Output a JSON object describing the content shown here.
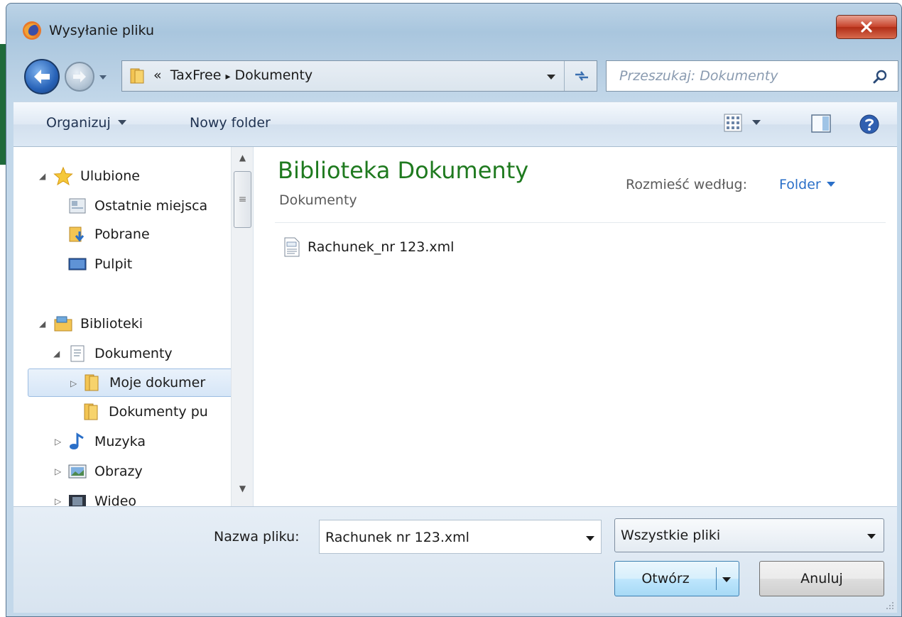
{
  "window": {
    "title": "Wysyłanie pliku",
    "close_icon": "close-icon",
    "accent": "#c7422a"
  },
  "navigation": {
    "breadcrumb_prefix": "«",
    "breadcrumb": [
      "TaxFree",
      "Dokumenty"
    ],
    "breadcrumb_separator": "▸",
    "search_placeholder": "Przeszukaj: Dokumenty"
  },
  "toolbar": {
    "organize_label": "Organizuj",
    "new_folder_label": "Nowy folder",
    "views_icon": "views-icon",
    "preview_icon": "preview-pane-icon",
    "help_icon": "help-icon"
  },
  "sidebar": {
    "favorites": {
      "label": "Ulubione",
      "items": [
        "Ostatnie miejsca",
        "Pobrane",
        "Pulpit"
      ]
    },
    "libraries": {
      "label": "Biblioteki",
      "documents": {
        "label": "Dokumenty",
        "children": [
          "Moje dokumer",
          "Dokumenty pu"
        ]
      },
      "items": [
        "Muzyka",
        "Obrazy",
        "Wideo"
      ]
    },
    "selected": "Moje dokumer"
  },
  "content": {
    "library_title": "Biblioteka Dokumenty",
    "library_subtitle": "Dokumenty",
    "arrange_label": "Rozmieść według:",
    "arrange_value": "Folder",
    "title_color": "#1f7a1f",
    "files": [
      {
        "name": "Rachunek_nr 123.xml",
        "icon": "xml-file-icon"
      }
    ]
  },
  "footer": {
    "filename_label": "Nazwa pliku:",
    "filename_value": "Rachunek nr 123.xml",
    "filter_value": "Wszystkie pliki",
    "open_label": "Otwórz",
    "cancel_label": "Anuluj"
  }
}
